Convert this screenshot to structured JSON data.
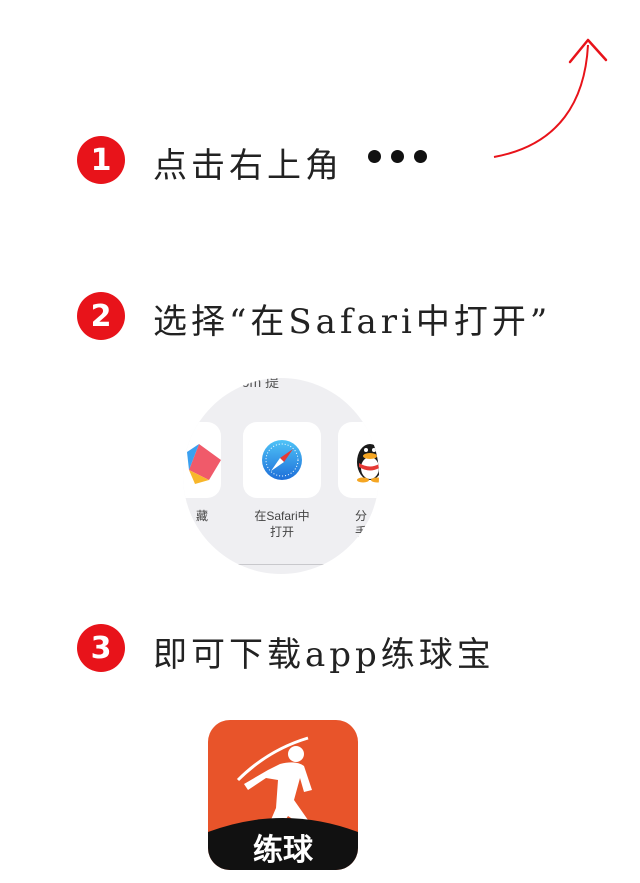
{
  "steps": [
    {
      "number": "1",
      "text": "点击右上角"
    },
    {
      "number": "2",
      "text": "选择“在Safari中打开”"
    },
    {
      "number": "3",
      "text": "即可下载app练球宝"
    }
  ],
  "share_sheet": {
    "url_fragment": "b.com 提",
    "items": [
      {
        "label": "藏",
        "icon": "bookmark-icon"
      },
      {
        "label": "在Safari中\n打开",
        "icon": "safari-compass-icon"
      },
      {
        "label": "分\n手",
        "icon": "qq-penguin-icon"
      }
    ]
  },
  "app": {
    "name": "练球",
    "icon": "golfer-icon",
    "brand_color": "#e8542a"
  },
  "colors": {
    "accent": "#e8131a",
    "arrow": "#e8131a"
  }
}
